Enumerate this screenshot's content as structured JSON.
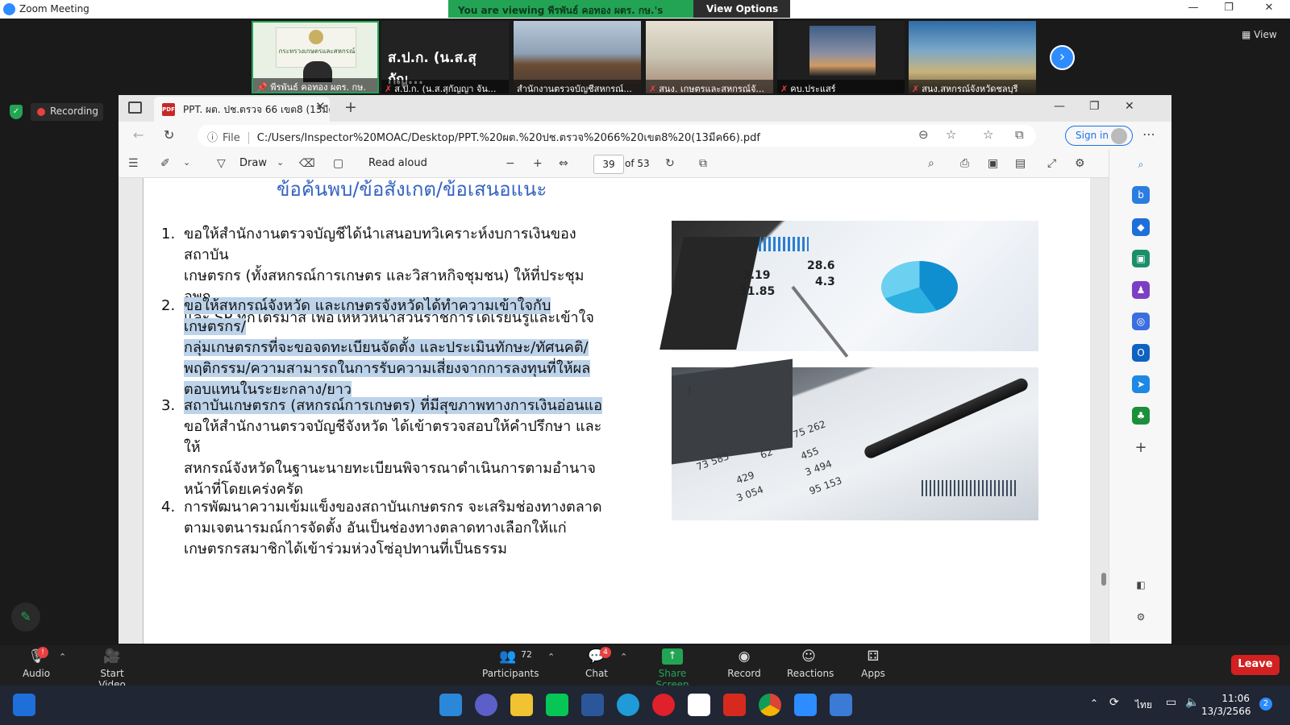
{
  "zoom": {
    "window_title": "Zoom Meeting",
    "viewing_banner": "You are viewing พีรพันธ์ คอทอง ผตร. กษ.'s screen",
    "view_options": "View Options",
    "view_label": "View",
    "recording_label": "Recording",
    "thumbnails": [
      {
        "name": "พีรพันธ์ คอทอง ผตร. กษ."
      },
      {
        "name": "ส.ป.ก. (น.ส.สุกัญญา จัน...",
        "big_text": "ส.ป.ก. (น.ส.สุกัญ..."
      },
      {
        "name": "สำนักงานตรวจบัญชีสหกรณ์..."
      },
      {
        "name": "สนง. เกษตรและสหกรณ์จั..."
      },
      {
        "name": "คบ.ประแสร์"
      },
      {
        "name": "สนง.สหกรณ์จังหวัดชลบุรี"
      }
    ],
    "thumb1_sign": "กระทรวงเกษตรและสหกรณ์"
  },
  "browser": {
    "tab_title": "PPT. ผต. ปช.ตรวจ 66 เขต8 (13มีค66",
    "tab_icon_text": "PDF",
    "url_info": "ⓘ",
    "url_scheme": "File",
    "url": "C:/Users/Inspector%20MOAC/Desktop/PPT.%20ผต.%20ปช.ตรวจ%2066%20เขต8%20(13มีค66).pdf",
    "sign_in": "Sign in"
  },
  "pdf_toolbar": {
    "draw": "Draw",
    "read_aloud": "Read aloud",
    "page_current": "39",
    "page_total": "of 53"
  },
  "document": {
    "heading": "ข้อค้นพบ/ข้อสังเกต/ข้อเสนอแนะ",
    "items": [
      {
        "num": "1.",
        "lines": [
          "ขอให้สำนักงานตรวจบัญชีได้นำเสนอบทวิเคราะห์งบการเงินของสถาบัน",
          "เกษตรกร (ทั้งสหกรณ์การเกษตร และวิสาหกิจชุมชน) ให้ที่ประชุม อพก",
          "และ SP ทุกไตรมาส เพื่อให้หัวหน้าส่วนราชการได้เรียนรู้และเข้าใจ"
        ]
      },
      {
        "num": "2.",
        "lines": [
          "ขอให้สหกรณ์จังหวัด และเกษตรจังหวัดได้ทำความเข้าใจกับเกษตรกร/",
          "กลุ่มเกษตรกรที่จะขอจดทะเบียนจัดตั้ง และประเมินทักษะ/ทัศนคติ/",
          "พฤติกรรม/ความสามารถในการรับความเสี่ยงจากการลงทุนที่ให้ผล",
          "ตอบแทนในระยะกลาง/ยาว"
        ]
      },
      {
        "num": "3.",
        "lines": [
          "สถาบันเกษตรกร (สหกรณ์การเกษตร) ที่มีสุขภาพทางการเงินอ่อนแอ",
          "ขอให้สำนักงานตรวจบัญชีจังหวัด ได้เข้าตรวจสอบให้คำปรึกษา และให้",
          "สหกรณ์จังหวัดในฐานะนายทะเบียนพิจารณาดำเนินการตามอำนาจ",
          "หน้าที่โดยเคร่งครัด"
        ]
      },
      {
        "num": "4.",
        "lines": [
          "การพัฒนาความเข้มแข็งของสถาบันเกษตรกร จะเสริมช่องทางตลาด",
          "ตามเจตนารมณ์การจัดตั้ง อันเป็นช่องทางตลาดทางเลือกให้แก่",
          "เกษตรกรสมาชิกได้เข้าร่วมห่วงโซ่อุปทานที่เป็นธรรม"
        ]
      }
    ],
    "image1_values": [
      "3.19",
      "31.85",
      "28.6",
      "4.3"
    ],
    "image2_values": [
      "73 583",
      "429",
      "3 054",
      "62",
      "75 262",
      "455",
      "3 494",
      "95 153"
    ]
  },
  "toolbar": {
    "audio": "Audio",
    "start_video": "Start Video",
    "participants": "Participants",
    "participants_count": "72",
    "chat": "Chat",
    "chat_badge": "4",
    "share_screen": "Share Screen",
    "record": "Record",
    "reactions": "Reactions",
    "apps": "Apps",
    "leave": "Leave",
    "audio_badge": "!"
  },
  "taskbar": {
    "language": "ไทย",
    "time": "11:06",
    "date": "13/3/2566",
    "notifications": "2"
  },
  "colors": {
    "zoom_blue": "#2d8cff",
    "banner_green": "#23a455",
    "leave_red": "#d32020",
    "heading_blue": "#3463c0",
    "highlight": "#bcd3ea"
  }
}
